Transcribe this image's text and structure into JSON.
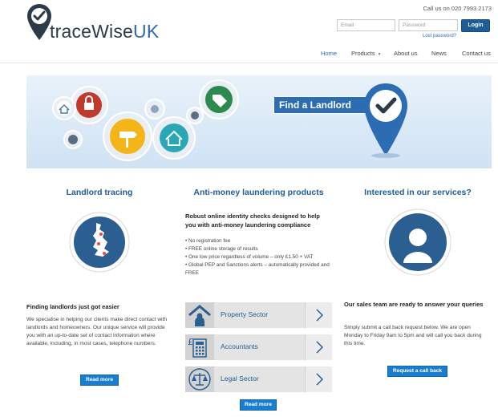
{
  "header": {
    "logo": {
      "text_main": "traceWise",
      "text_accent": "UK"
    },
    "phone": "Call us on 020 7993 2173",
    "login": {
      "email_placeholder": "Email",
      "password_placeholder": "Password",
      "button_label": "Login",
      "lost_password": "Lost password?"
    },
    "nav": [
      {
        "label": "Home",
        "active": true
      },
      {
        "label": "Products",
        "has_dropdown": true
      },
      {
        "label": "About us"
      },
      {
        "label": "News"
      },
      {
        "label": "Contact us"
      }
    ]
  },
  "banner": {
    "label": "Find a Landlord",
    "icons": [
      "lock-icon",
      "house-icon",
      "tag-icon",
      "signpost-icon",
      "home-heart-icon",
      "map-pin-icon",
      "check-pin-icon"
    ]
  },
  "columns": {
    "landlord": {
      "title": "Landlord tracing",
      "image": "uk-map-icon",
      "subtitle": "Finding landlords just got easier",
      "body": "We specialise in helping our clients make direct contact with landlords and homeowners. Our unique service will provide you with an up-to-date set of contact information where available, including, in most cases, telephone numbers.",
      "button": "Read more"
    },
    "aml": {
      "title": "Anti-money laundering products",
      "intro": "Robust online identity checks designed to help you with anti-money laundering compliance",
      "bullets": [
        "• No registration fee",
        "• FREE online storage of results",
        "• One low price regardless of volume – only £1.50 + VAT",
        "• Global PEP and Sanctions alerts – automatically provided and FREE"
      ],
      "sectors": [
        {
          "label": "Property Sector",
          "icon": "house-person-icon"
        },
        {
          "label": "Accountants",
          "icon": "calculator-icon"
        },
        {
          "label": "Legal Sector",
          "icon": "scales-icon"
        }
      ],
      "button": "Read more"
    },
    "contact": {
      "title": "Interested in our services?",
      "image": "headset-operator-icon",
      "subtitle": "Our sales team are ready to answer your queries",
      "body": "Simply submit a call back request below. We are open Monday to Friday 9am to 5pm and will call you back during this time.",
      "button": "Request a call back"
    }
  },
  "colors": {
    "brand_blue": "#1f5d97",
    "button_blue": "#1a7ed0",
    "banner_bg": "#d8e8f7"
  }
}
